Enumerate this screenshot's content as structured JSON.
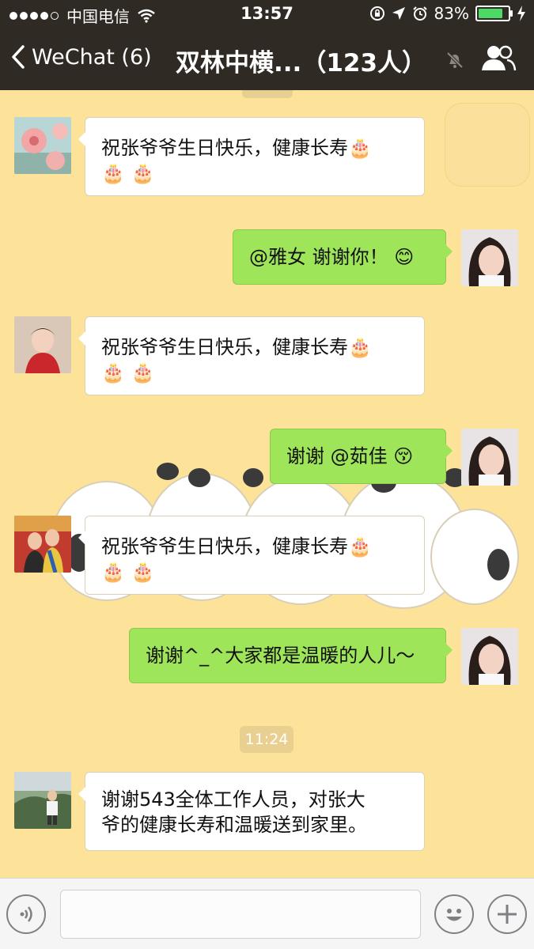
{
  "status_bar": {
    "carrier": "中国电信",
    "time": "13:57",
    "battery_percent": "83%",
    "battery_level": 0.83
  },
  "nav": {
    "back_label": "WeChat (6)",
    "title": "双林中横...（123人）"
  },
  "messages": [
    {
      "direction": "in",
      "text": "祝张爷爷生日快乐，健康长寿",
      "emoji": [
        "🎂",
        "🎂",
        "🎂"
      ]
    },
    {
      "direction": "out",
      "text": "@雅女 谢谢你！",
      "emoji": [
        "😊"
      ]
    },
    {
      "direction": "in",
      "text": "祝张爷爷生日快乐，健康长寿",
      "emoji": [
        "🎂",
        "🎂",
        "🎂"
      ]
    },
    {
      "direction": "out",
      "text": "谢谢 @茹佳",
      "emoji": [
        "😚"
      ]
    },
    {
      "direction": "in",
      "text": "祝张爷爷生日快乐，健康长寿",
      "emoji": [
        "🎂",
        "🎂",
        "🎂"
      ]
    },
    {
      "direction": "out",
      "text": "谢谢^_^大家都是温暖的人儿～"
    },
    {
      "direction": "in",
      "text_line1": "谢谢543全体工作人员，对张大",
      "text_line2": "爷的健康长寿和温暖送到家里。"
    }
  ],
  "time_divider": "11:24",
  "input": {
    "placeholder": ""
  },
  "icons": {
    "back": "chevron-left-icon",
    "mute": "bell-slash-icon",
    "members": "people-icon",
    "voice": "voice-icon",
    "emoji": "smiley-icon",
    "more": "plus-icon"
  },
  "colors": {
    "header": "#2f2a24",
    "chat_background": "#fde39a",
    "outgoing_bubble": "#9fe55a",
    "incoming_bubble": "#ffffff"
  }
}
